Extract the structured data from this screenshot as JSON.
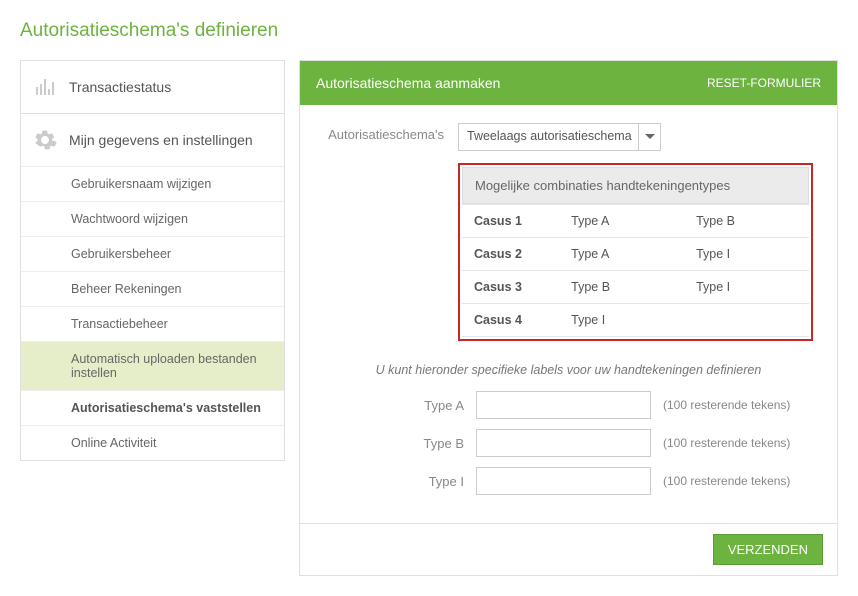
{
  "page": {
    "title": "Autorisatieschema's definieren"
  },
  "sidebar": {
    "sections": [
      {
        "label": "Transactiestatus"
      },
      {
        "label": "Mijn gegevens en instellingen",
        "items": [
          {
            "label": "Gebruikersnaam wijzigen"
          },
          {
            "label": "Wachtwoord wijzigen"
          },
          {
            "label": "Gebruikersbeheer"
          },
          {
            "label": "Beheer Rekeningen"
          },
          {
            "label": "Transactiebeheer"
          },
          {
            "label": "Automatisch uploaden bestanden instellen"
          },
          {
            "label": "Autorisatieschema's vaststellen"
          },
          {
            "label": "Online Activiteit"
          }
        ]
      }
    ]
  },
  "panel": {
    "title": "Autorisatieschema aanmaken",
    "reset": "RESET-FORMULIER",
    "schema_label": "Autorisatieschema's",
    "schema_select": "Tweelaags autorisatieschema",
    "combos": {
      "header": "Mogelijke combinaties handtekeningentypes",
      "rows": [
        {
          "name": "Casus 1",
          "c1": "Type A",
          "c2": "Type B"
        },
        {
          "name": "Casus 2",
          "c1": "Type A",
          "c2": "Type I"
        },
        {
          "name": "Casus 3",
          "c1": "Type B",
          "c2": "Type I"
        },
        {
          "name": "Casus 4",
          "c1": "Type I",
          "c2": ""
        }
      ]
    },
    "subtext": "U kunt hieronder specifieke labels voor uw handtekeningen definieren",
    "labels": [
      {
        "name": "Type A",
        "hint": "(100 resterende tekens)"
      },
      {
        "name": "Type B",
        "hint": "(100 resterende tekens)"
      },
      {
        "name": "Type I",
        "hint": "(100 resterende tekens)"
      }
    ],
    "submit": "VERZENDEN"
  }
}
